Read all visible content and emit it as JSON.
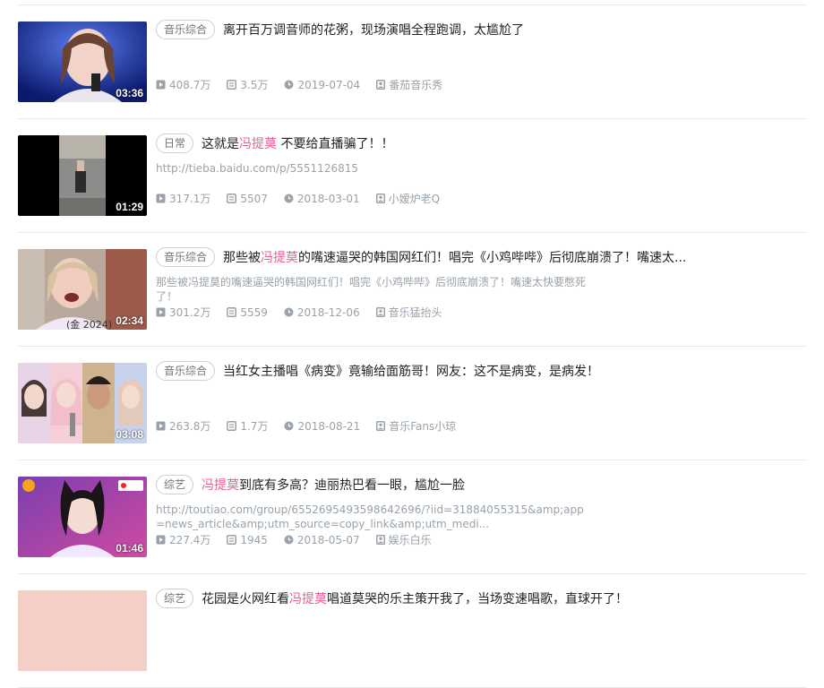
{
  "videos": [
    {
      "tag": "音乐综合",
      "title_parts": [
        {
          "t": "离开百万调音师的花粥，现场演唱全程跑调，太尴尬了",
          "hl": false
        }
      ],
      "description": "",
      "duration": "03:36",
      "views": "408.7万",
      "danmaku": "3.5万",
      "date": "2019-07-04",
      "uploader": "番茄音乐秀"
    },
    {
      "tag": "日常",
      "title_parts": [
        {
          "t": "这就是",
          "hl": false
        },
        {
          "t": "冯提莫",
          "hl": true
        },
        {
          "t": " 不要给直播骗了！！",
          "hl": false
        }
      ],
      "description": "http://tieba.baidu.com/p/5551126815",
      "duration": "01:29",
      "views": "317.1万",
      "danmaku": "5507",
      "date": "2018-03-01",
      "uploader": "小嫒炉老Q"
    },
    {
      "tag": "音乐综合",
      "title_parts": [
        {
          "t": "那些被",
          "hl": false
        },
        {
          "t": "冯提莫",
          "hl": true
        },
        {
          "t": "的嘴速逼哭的韩国网红们！唱完《小鸡哔哔》后彻底崩溃了！嘴速太...",
          "hl": false
        }
      ],
      "description": "那些被冯提莫的嘴速逼哭的韩国网红们！唱完《小鸡哔哔》后彻底崩溃了！嘴速太快要憋死了！",
      "duration": "02:34",
      "views": "301.2万",
      "danmaku": "5559",
      "date": "2018-12-06",
      "uploader": "音乐猛抬头"
    },
    {
      "tag": "音乐综合",
      "title_parts": [
        {
          "t": "当红女主播唱《病变》竟输给面筋哥！网友：这不是病变，是病发！",
          "hl": false
        }
      ],
      "description": "",
      "duration": "03:08",
      "views": "263.8万",
      "danmaku": "1.7万",
      "date": "2018-08-21",
      "uploader": "音乐Fans小琼"
    },
    {
      "tag": "综艺",
      "title_parts": [
        {
          "t": "冯提莫",
          "hl": true
        },
        {
          "t": "到底有多高？迪丽热巴看一眼，尴尬一脸",
          "hl": false
        }
      ],
      "description": "http://toutiao.com/group/6552695493598642696/?iid=31884055315&amp;app=news_article&amp;utm_source=copy_link&amp;utm_medi...",
      "duration": "01:46",
      "views": "227.4万",
      "danmaku": "1945",
      "date": "2018-05-07",
      "uploader": "娱乐白乐"
    },
    {
      "tag": "综艺",
      "title_parts": [
        {
          "t": "花园是火网红看",
          "hl": false
        },
        {
          "t": "冯提莫",
          "hl": true
        },
        {
          "t": "唱道莫哭的乐主策开我了，当场变速唱歌，直球开了！",
          "hl": false
        }
      ],
      "description": "",
      "duration": "",
      "views": "",
      "danmaku": "",
      "date": "",
      "uploader": ""
    }
  ],
  "icons": {
    "views": "play-icon",
    "danmaku": "danmaku-icon",
    "date": "clock-icon",
    "uploader": "uploader-icon"
  },
  "colors": {
    "highlight": "#f25d8e",
    "meta": "#99a2aa",
    "tag_border": "#cfcfcf"
  }
}
